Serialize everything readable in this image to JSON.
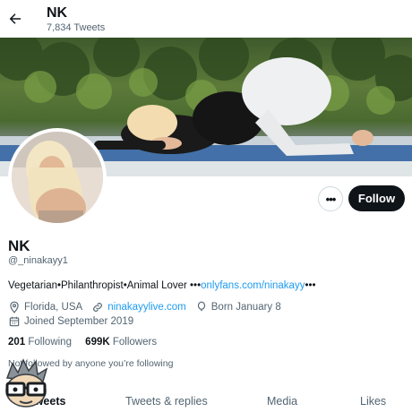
{
  "header": {
    "title": "NK",
    "tweet_count": "7,834 Tweets"
  },
  "profile": {
    "name": "NK",
    "handle": "@_ninakayy1",
    "bio_text": "Vegetarian•Philanthropist•Animal Lover •••",
    "bio_link": "onlyfans.com/ninakayy",
    "bio_suffix": "•••",
    "location": "Florida, USA",
    "website": "ninakayylive.com",
    "birthday": "Born January 8",
    "joined": "Joined September 2019"
  },
  "stats": {
    "following_count": "201",
    "following_label": "Following",
    "followers_count": "699K",
    "followers_label": "Followers"
  },
  "buttons": {
    "more": "•••",
    "follow": "Follow"
  },
  "not_followed": "Not followed by anyone you’re following",
  "tabs": [
    {
      "label": "Tweets"
    },
    {
      "label": "Tweets & replies"
    },
    {
      "label": "Media"
    },
    {
      "label": "Likes"
    }
  ],
  "icons": {
    "back": "arrow-left-icon",
    "location": "location-pin-icon",
    "link": "link-icon",
    "birthday": "balloon-icon",
    "joined": "calendar-icon"
  },
  "colors": {
    "accent": "#1d9bf0",
    "follow_bg": "#0f1419",
    "muted": "#536471"
  }
}
